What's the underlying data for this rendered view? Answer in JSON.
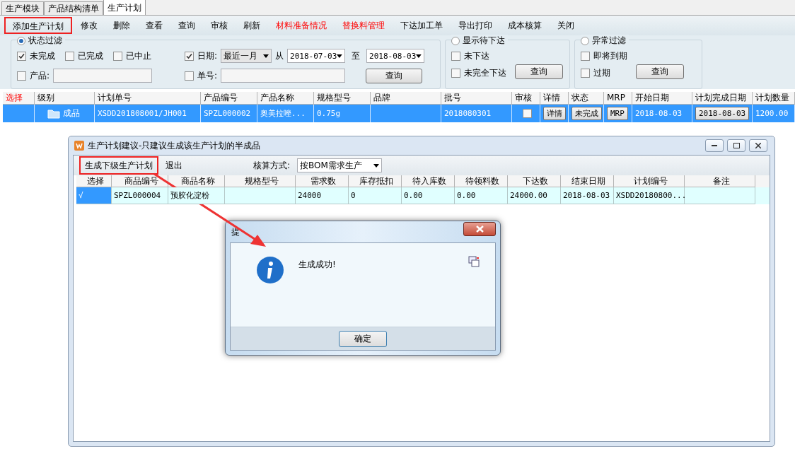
{
  "tabs": [
    {
      "label": "生产模块",
      "selected": false
    },
    {
      "label": "产品结构清单",
      "selected": false
    },
    {
      "label": "生产计划",
      "selected": true
    }
  ],
  "toolbar": [
    {
      "label": "添加生产计划",
      "emphasis": false,
      "highlighted": true
    },
    {
      "label": "修改",
      "emphasis": false,
      "highlighted": false
    },
    {
      "label": "删除",
      "emphasis": false,
      "highlighted": false
    },
    {
      "label": "查看",
      "emphasis": false,
      "highlighted": false
    },
    {
      "label": "查询",
      "emphasis": false,
      "highlighted": false
    },
    {
      "label": "审核",
      "emphasis": false,
      "highlighted": false
    },
    {
      "label": "刷新",
      "emphasis": false,
      "highlighted": false
    },
    {
      "label": "材料准备情况",
      "emphasis": true,
      "highlighted": false
    },
    {
      "label": "替换料管理",
      "emphasis": true,
      "highlighted": false
    },
    {
      "label": "下达加工单",
      "emphasis": false,
      "highlighted": false
    },
    {
      "label": "导出打印",
      "emphasis": false,
      "highlighted": false
    },
    {
      "label": "成本核算",
      "emphasis": false,
      "highlighted": false
    },
    {
      "label": "关闭",
      "emphasis": false,
      "highlighted": false
    }
  ],
  "status_filter": {
    "label": "状态过滤",
    "selected": true,
    "checks": [
      {
        "label": "未完成",
        "checked": true
      },
      {
        "label": "已完成",
        "checked": false
      },
      {
        "label": "已中止",
        "checked": false
      }
    ],
    "date": {
      "label": "日期:",
      "checked": true,
      "range": "最近一月",
      "from_label": "从",
      "from": "2018-07-03",
      "to_label": "至",
      "to": "2018-08-03"
    },
    "product": {
      "label": "产品:",
      "checked": false
    },
    "order_no": {
      "label": "单号:",
      "checked": false
    },
    "query": "查询"
  },
  "pending_filter": {
    "label": "显示待下达",
    "selected": false,
    "checks": [
      {
        "label": "未下达",
        "checked": false
      },
      {
        "label": "未完全下达",
        "checked": false
      }
    ],
    "query": "查询"
  },
  "exception_filter": {
    "label": "异常过滤",
    "selected": false,
    "checks": [
      {
        "label": "即将到期",
        "checked": false
      },
      {
        "label": "过期",
        "checked": false
      }
    ],
    "query": "查询"
  },
  "table": {
    "columns": [
      {
        "label": "选择",
        "emphasis": true
      },
      {
        "label": "级别",
        "emphasis": false
      },
      {
        "label": "计划单号",
        "emphasis": false
      },
      {
        "label": "产品编号",
        "emphasis": false
      },
      {
        "label": "产品名称",
        "emphasis": false
      },
      {
        "label": "规格型号",
        "emphasis": false
      },
      {
        "label": "品牌",
        "emphasis": false
      },
      {
        "label": "批号",
        "emphasis": false
      },
      {
        "label": "审核",
        "emphasis": false
      },
      {
        "label": "详情",
        "emphasis": false
      },
      {
        "label": "状态",
        "emphasis": false
      },
      {
        "label": "MRP",
        "emphasis": false
      },
      {
        "label": "开始日期",
        "emphasis": false
      },
      {
        "label": "计划完成日期",
        "emphasis": false
      },
      {
        "label": "计划数量",
        "emphasis": false
      }
    ],
    "rows": [
      {
        "selected": true,
        "cells": [
          {
            "kind": "text",
            "text": ""
          },
          {
            "kind": "tree",
            "text": "成品"
          },
          {
            "kind": "text",
            "text": "XSDD201808001/JH001"
          },
          {
            "kind": "text",
            "text": "SPZL000002"
          },
          {
            "kind": "text",
            "text": "奥美拉唑..."
          },
          {
            "kind": "text",
            "text": "0.75g"
          },
          {
            "kind": "text",
            "text": ""
          },
          {
            "kind": "text",
            "text": "2018080301"
          },
          {
            "kind": "checkbox",
            "checked": false
          },
          {
            "kind": "button",
            "text": "详情"
          },
          {
            "kind": "button",
            "text": "未完成"
          },
          {
            "kind": "button",
            "text": "MRP"
          },
          {
            "kind": "text",
            "text": "2018-08-03"
          },
          {
            "kind": "button",
            "text": "2018-08-03"
          },
          {
            "kind": "text",
            "text": "1200.00"
          }
        ]
      }
    ]
  },
  "sub_window": {
    "title": "生产计划建议-只建议生成该生产计划的半成品",
    "toolbar": [
      {
        "label": "生成下级生产计划",
        "highlighted": true
      },
      {
        "label": "退出",
        "highlighted": false
      }
    ],
    "method_label": "核算方式:",
    "method": "按BOM需求生产",
    "columns": [
      "选择",
      "商品编号",
      "商品名称",
      "规格型号",
      "需求数",
      "库存抵扣",
      "待入库数",
      "待领料数",
      "下达数",
      "结束日期",
      "计划编号",
      "备注"
    ],
    "rows": [
      {
        "cells": [
          {
            "text": "√",
            "selected": true
          },
          {
            "text": "SPZL000004",
            "selected": false
          },
          {
            "text": "预胶化淀粉",
            "selected": false
          },
          {
            "text": "",
            "selected": false
          },
          {
            "text": "24000",
            "selected": false
          },
          {
            "text": "0",
            "selected": false
          },
          {
            "text": "0.00",
            "selected": false
          },
          {
            "text": "0.00",
            "selected": false
          },
          {
            "text": "24000.00",
            "selected": false
          },
          {
            "text": "2018-08-03",
            "selected": false
          },
          {
            "text": "XSDD20180800...",
            "selected": false
          },
          {
            "text": "",
            "selected": false
          }
        ]
      }
    ]
  },
  "dialog": {
    "title": "提",
    "message": "生成成功!",
    "ok": "确定"
  }
}
